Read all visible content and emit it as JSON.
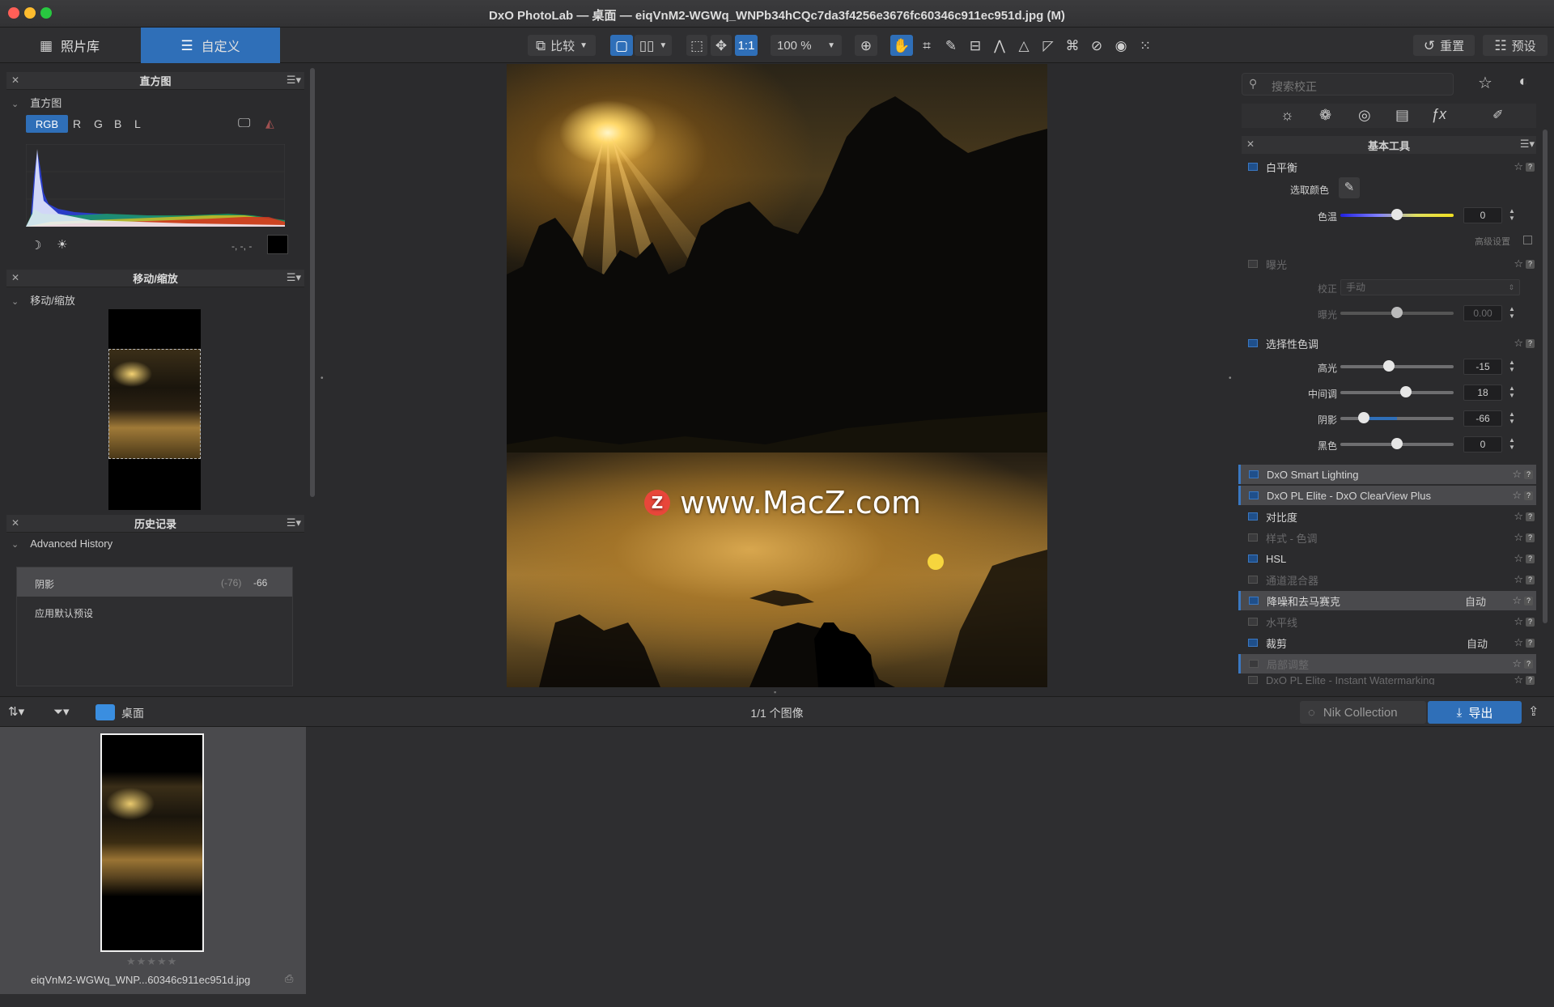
{
  "window": {
    "title": "DxO PhotoLab — 桌面 — eiqVnM2-WGWq_WNPb34hCQc7da3f4256e3676fc60346c911ec951d.jpg (M)",
    "colors": {
      "close": "#ff5f57",
      "minimize": "#febc2e",
      "zoom": "#28c840",
      "accent": "#2f6fb8"
    }
  },
  "toolbar": {
    "tab_library": "照片库",
    "tab_customize": "自定义",
    "compare": "比较",
    "one_to_one": "1:1",
    "zoom": "100 %",
    "reset": "重置",
    "presets": "预设"
  },
  "left": {
    "histogram_panel_title": "直方图",
    "histogram_sub": "直方图",
    "channels": [
      "RGB",
      "R",
      "G",
      "B",
      "L"
    ],
    "histogram_readout": "-, -, -",
    "move_zoom_panel_title": "移动/缩放",
    "move_zoom_sub": "移动/缩放",
    "history_panel_title": "历史记录",
    "history_sub": "Advanced History",
    "history_items": [
      {
        "label": "阴影",
        "old": "(-76)",
        "new": "-66"
      },
      {
        "label": "应用默认预设",
        "old": "",
        "new": ""
      }
    ]
  },
  "viewer": {
    "watermark": "www.MacZ.com",
    "watermark_logo": "Z"
  },
  "right": {
    "search_placeholder": "搜索校正",
    "basic_tools_title": "基本工具",
    "white_balance": "白平衡",
    "pick_color": "选取颜色",
    "temperature_label": "色温",
    "temperature_value": "0",
    "advanced_settings": "高级设置",
    "exposure": "曝光",
    "correction_label": "校正",
    "correction_value": "手动",
    "exposure_label": "曝光",
    "exposure_value": "0.00",
    "selective_tone": "选择性色调",
    "highlights_label": "高光",
    "highlights_value": "-15",
    "midtones_label": "中间调",
    "midtones_value": "18",
    "shadows_label": "阴影",
    "shadows_value": "-66",
    "blacks_label": "黑色",
    "blacks_value": "0",
    "tools": [
      {
        "label": "DxO Smart Lighting",
        "auto": "",
        "state": "hl"
      },
      {
        "label": "DxO PL Elite - DxO ClearView Plus",
        "auto": "",
        "state": "hl"
      },
      {
        "label": "对比度",
        "auto": "",
        "state": "on"
      },
      {
        "label": "样式 - 色调",
        "auto": "",
        "state": "dim"
      },
      {
        "label": "HSL",
        "auto": "",
        "state": "on"
      },
      {
        "label": "通道混合器",
        "auto": "",
        "state": "dim"
      },
      {
        "label": "降噪和去马赛克",
        "auto": "自动",
        "state": "hl"
      },
      {
        "label": "水平线",
        "auto": "",
        "state": "dim"
      },
      {
        "label": "裁剪",
        "auto": "自动",
        "state": "on"
      },
      {
        "label": "局部调整",
        "auto": "",
        "state": "dimhl"
      },
      {
        "label": "DxO PL Elite - Instant Watermarking",
        "auto": "",
        "state": "dim"
      }
    ]
  },
  "bottom": {
    "folder": "桌面",
    "count": "1/1 个图像",
    "nik": "Nik Collection",
    "export": "导出",
    "thumb_name": "eiqVnM2-WGWq_WNP...60346c911ec951d.jpg",
    "rating": "★★★★★"
  }
}
